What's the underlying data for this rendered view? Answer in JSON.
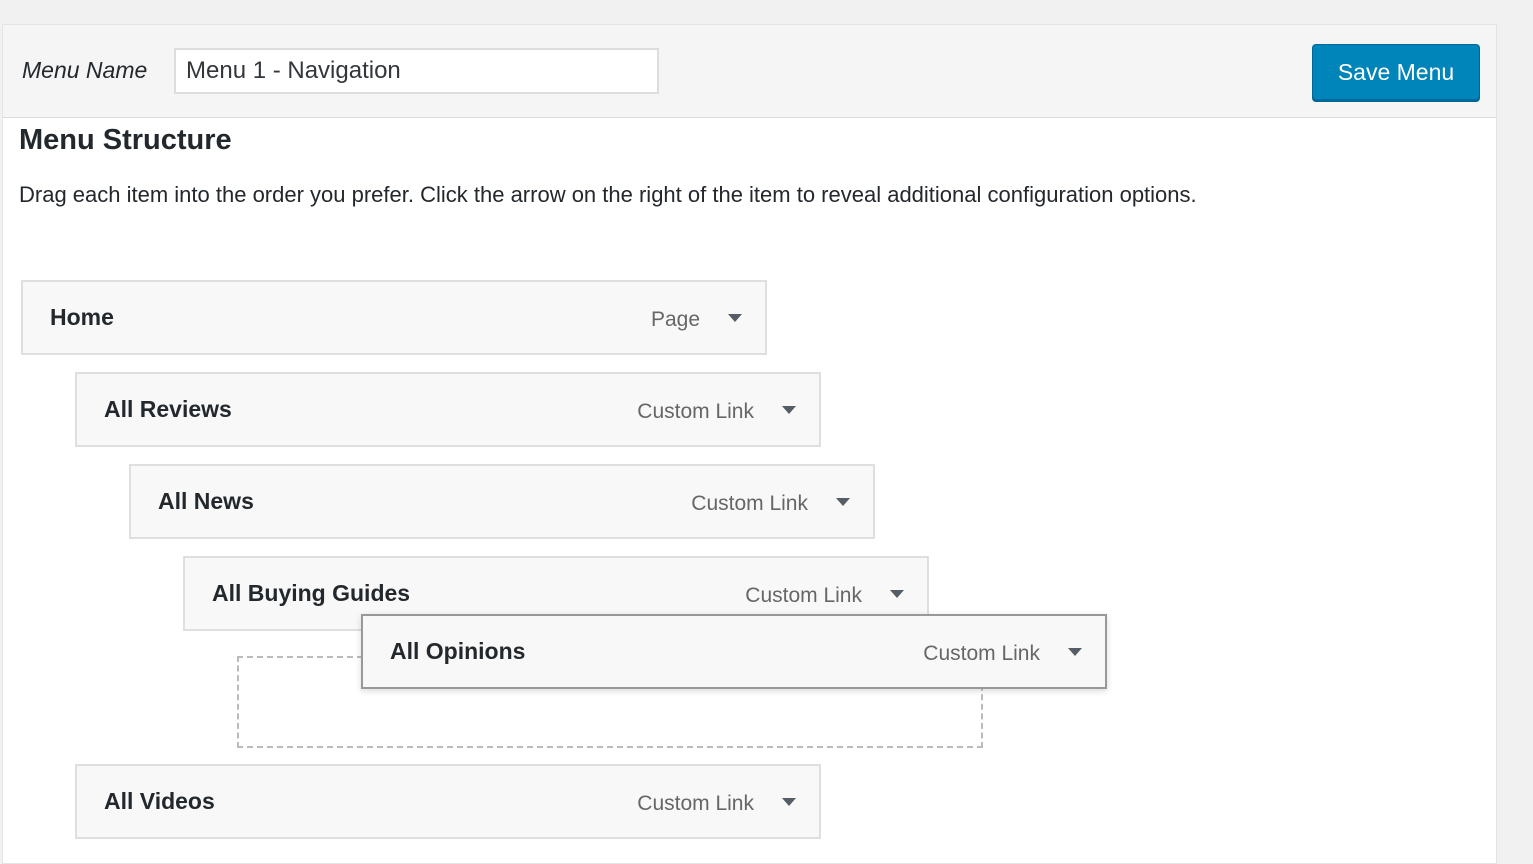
{
  "header": {
    "menu_name_label": "Menu Name",
    "menu_name_value": "Menu 1 - Navigation",
    "save_label": "Save Menu"
  },
  "structure": {
    "title": "Menu Structure",
    "description": "Drag each item into the order you prefer. Click the arrow on the right of the item to reveal additional configuration options."
  },
  "items": [
    {
      "title": "Home",
      "type": "Page",
      "depth": 0
    },
    {
      "title": "All Reviews",
      "type": "Custom Link",
      "depth": 1
    },
    {
      "title": "All News",
      "type": "Custom Link",
      "depth": 2
    },
    {
      "title": "All Buying Guides",
      "type": "Custom Link",
      "depth": 3
    },
    {
      "title": "All Opinions",
      "type": "Custom Link",
      "depth": 4,
      "state": "dragging"
    },
    {
      "title": "All Videos",
      "type": "Custom Link",
      "depth": 1
    }
  ],
  "icons": {
    "toggle": "triangle-down-icon"
  },
  "colors": {
    "primary_button": "#0085ba",
    "item_background": "#f8f8f8",
    "item_border": "#dfdfdf"
  }
}
